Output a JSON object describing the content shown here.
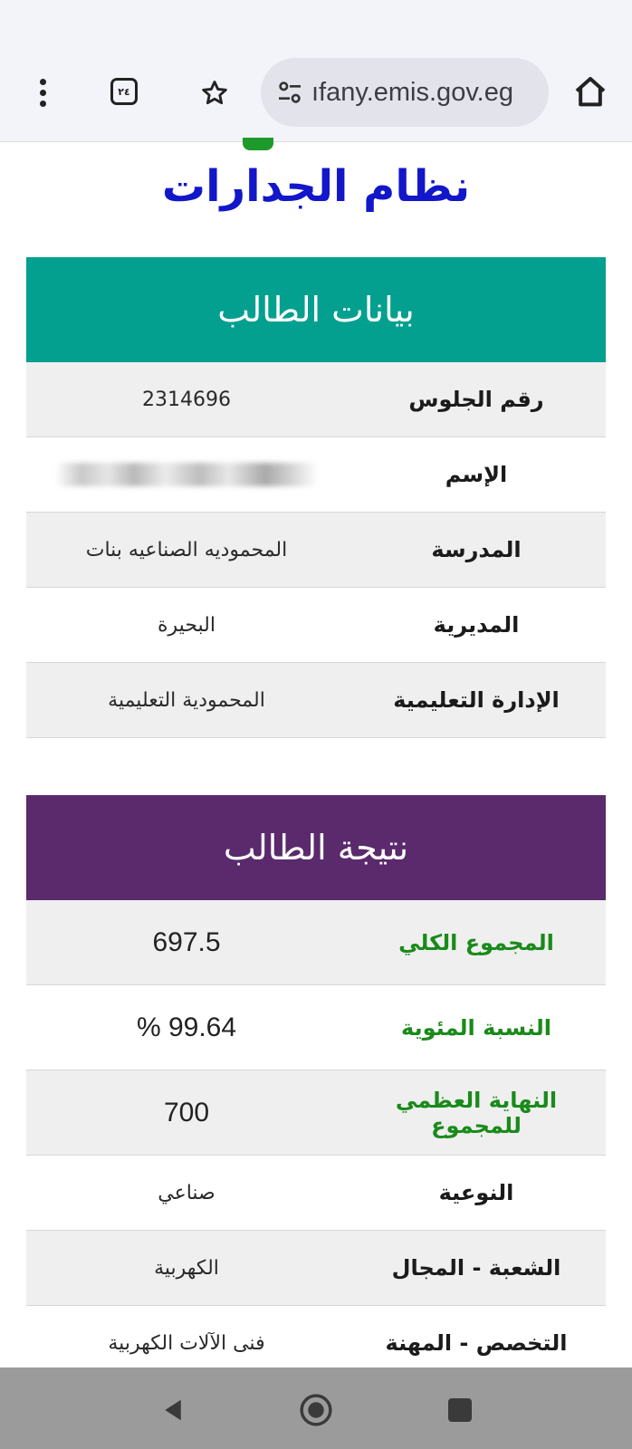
{
  "browser": {
    "tab_count": "٢٤",
    "url": "ıfany.emis.gov.eg",
    "icons": [
      "menu-icon",
      "tabs-icon",
      "star-icon",
      "site-settings-icon",
      "home-icon"
    ]
  },
  "page": {
    "title": "نظام الجدارات"
  },
  "student_card": {
    "header": "بيانات الطالب",
    "rows": [
      {
        "label": "رقم الجلوس",
        "value": "2314696"
      },
      {
        "label": "الإسم",
        "value": ""
      },
      {
        "label": "المدرسة",
        "value": "المحموديه الصناعيه بنات"
      },
      {
        "label": "المديرية",
        "value": "البحيرة"
      },
      {
        "label": "الإدارة التعليمية",
        "value": "المحمودية التعليمية"
      }
    ]
  },
  "result_card": {
    "header": "نتيجة الطالب",
    "rows": [
      {
        "label": "المجموع الكلي",
        "value": "697.5"
      },
      {
        "label": "النسبة المئوية",
        "value": "99.64 %"
      },
      {
        "label": "النهاية العظمي للمجموع",
        "value": "700"
      },
      {
        "label": "النوعية",
        "value": "صناعي"
      },
      {
        "label": "الشعبة - المجال",
        "value": "الكهربية"
      },
      {
        "label": "التخصص - المهنة",
        "value": "فنى الآلات الكهربية"
      }
    ]
  },
  "colors": {
    "title_blue": "#1217c9",
    "student_header": "#03a08f",
    "result_header": "#5a2a6d",
    "result_label_green": "#1a8a1a"
  },
  "navbar": {
    "icons": [
      "back-icon",
      "home-circle-icon",
      "recents-icon"
    ]
  }
}
